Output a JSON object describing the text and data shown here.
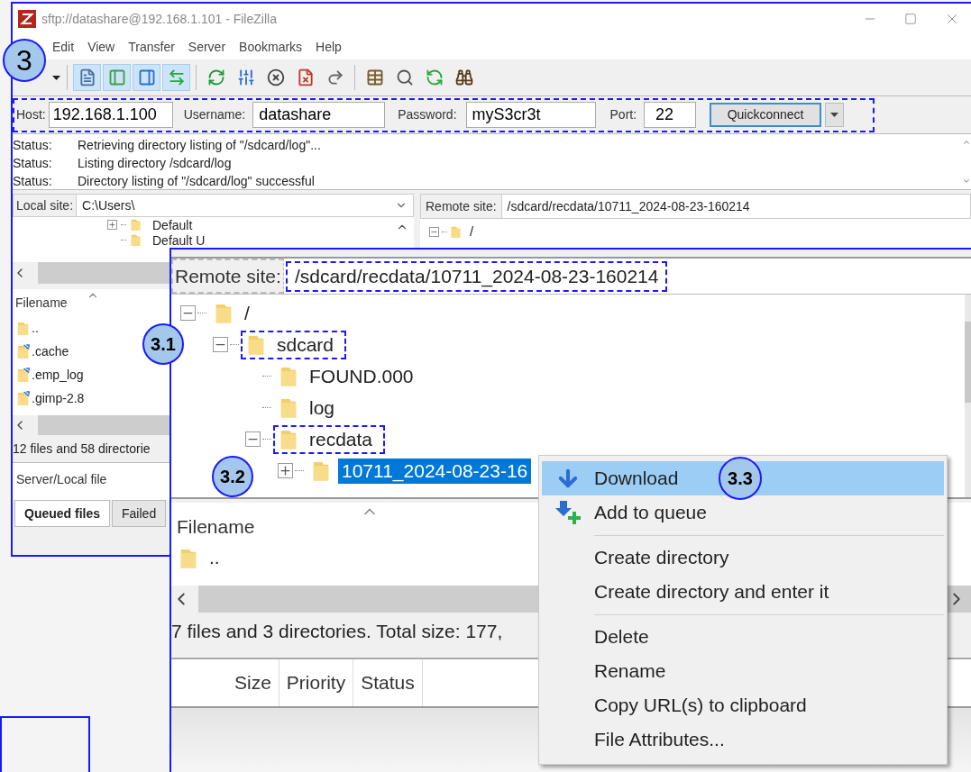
{
  "window": {
    "title": "sftp://datashare@192.168.1.101 - FileZilla"
  },
  "menu": [
    "Edit",
    "View",
    "Transfer",
    "Server",
    "Bookmarks",
    "Help"
  ],
  "toolbar": [
    {
      "kind": "caret",
      "selected": false
    },
    {
      "kind": "message-log",
      "selected": true
    },
    {
      "kind": "local-tree",
      "selected": true
    },
    {
      "kind": "remote-tree",
      "selected": true
    },
    {
      "kind": "queue",
      "selected": true
    },
    {
      "kind": "refresh",
      "selected": false
    },
    {
      "kind": "process",
      "selected": false
    },
    {
      "kind": "cancel",
      "selected": false
    },
    {
      "kind": "disconnect",
      "selected": false
    },
    {
      "kind": "reconnect",
      "selected": false
    },
    {
      "kind": "filter",
      "selected": false
    },
    {
      "kind": "search",
      "selected": false
    },
    {
      "kind": "compare",
      "selected": false
    },
    {
      "kind": "find",
      "selected": false
    }
  ],
  "quickconnect": {
    "outlined": true,
    "host_label": "Host:",
    "host": "192.168.1.100",
    "username_label": "Username:",
    "username": "datashare",
    "password_label": "Password:",
    "password": "myS3cr3t",
    "port_label": "Port:",
    "port": "22",
    "button": "Quickconnect"
  },
  "message_log": [
    {
      "label": "Status:",
      "text": "Retrieving directory listing of \"/sdcard/log\"..."
    },
    {
      "label": "Status:",
      "text": "Listing directory /sdcard/log"
    },
    {
      "label": "Status:",
      "text": "Directory listing of \"/sdcard/log\" successful"
    }
  ],
  "local": {
    "site_label": "Local site:",
    "path": "C:\\Users\\",
    "tree": [
      {
        "name": "Default",
        "expanded": false
      },
      {
        "name": "Default U"
      }
    ],
    "filename_header": "Filename",
    "files": [
      {
        "name": "..",
        "kind": "folder"
      },
      {
        "name": ".cache",
        "kind": "link"
      },
      {
        "name": ".emp_log",
        "kind": "link"
      },
      {
        "name": ".gimp-2.8",
        "kind": "link"
      }
    ],
    "status": "12 files and 58 directorie"
  },
  "remote": {
    "site_label": "Remote site:",
    "path": "/sdcard/recdata/10711_2024-08-23-160214",
    "tree": [
      {
        "name": "/",
        "expanded": true
      }
    ]
  },
  "queue": {
    "column": "Server/Local file",
    "tabs": [
      {
        "label": "Queued files",
        "selected": true
      },
      {
        "label": "Failed",
        "selected": false
      }
    ]
  },
  "zoom_inset": {
    "site_label": "Remote site:",
    "label_outlined": true,
    "path": "/sdcard/recdata/10711_2024-08-23-160214",
    "path_outlined": true,
    "tree": [
      {
        "name": "/",
        "expanded": true,
        "selected": false,
        "outlined": false,
        "children": [
          {
            "name": "sdcard",
            "expanded": true,
            "selected": false,
            "outlined": true,
            "children": [
              {
                "name": "FOUND.000",
                "selected": false,
                "outlined": false
              },
              {
                "name": "log",
                "selected": false,
                "outlined": false
              },
              {
                "name": "recdata",
                "expanded": true,
                "selected": false,
                "outlined": true,
                "children": [
                  {
                    "name": "10711_2024-08-23-16",
                    "expanded": false,
                    "selected": true,
                    "outlined": false
                  }
                ]
              }
            ]
          }
        ]
      }
    ],
    "filename_header": "Filename",
    "files": [
      {
        "name": ".."
      }
    ],
    "status": "7 files and 3 directories. Total size: 177,",
    "queue_columns": [
      "Size",
      "Priority",
      "Status"
    ]
  },
  "context_menu": [
    {
      "kind": "download",
      "label": "Download",
      "selected": true
    },
    {
      "kind": "add-queue",
      "label": "Add to queue",
      "selected": false
    },
    {
      "kind": "separator"
    },
    {
      "kind": "item",
      "label": "Create directory",
      "selected": false
    },
    {
      "kind": "item",
      "label": "Create directory and enter it",
      "selected": false
    },
    {
      "kind": "separator"
    },
    {
      "kind": "item",
      "label": "Delete",
      "selected": false
    },
    {
      "kind": "item",
      "label": "Rename",
      "selected": false
    },
    {
      "kind": "item",
      "label": "Copy URL(s) to clipboard",
      "selected": false
    },
    {
      "kind": "item",
      "label": "File Attributes...",
      "selected": false
    }
  ],
  "callouts": [
    {
      "label": "3"
    },
    {
      "label": "3.1"
    },
    {
      "label": "3.2"
    },
    {
      "label": "3.3"
    }
  ]
}
